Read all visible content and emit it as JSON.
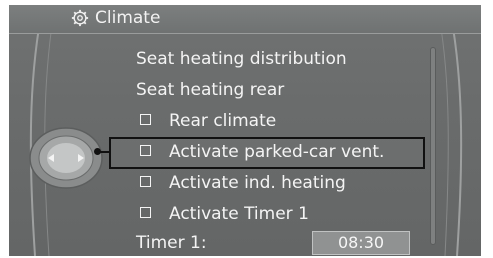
{
  "header": {
    "title": "Climate",
    "icon": "gear-icon"
  },
  "menu": {
    "items": [
      {
        "label": "Seat heating distribution",
        "checkbox": false
      },
      {
        "label": "Seat heating rear",
        "checkbox": false
      },
      {
        "label": "Rear climate",
        "checkbox": true
      },
      {
        "label": "Activate parked-car vent.",
        "checkbox": true,
        "selected": true
      },
      {
        "label": "Activate ind. heating",
        "checkbox": true
      },
      {
        "label": "Activate Timer 1",
        "checkbox": true
      }
    ]
  },
  "timer": {
    "label": "Timer 1:",
    "value": "08:30"
  },
  "colors": {
    "background": "#6c6e6e",
    "text": "#f4f4f4",
    "frame": "#111111"
  }
}
